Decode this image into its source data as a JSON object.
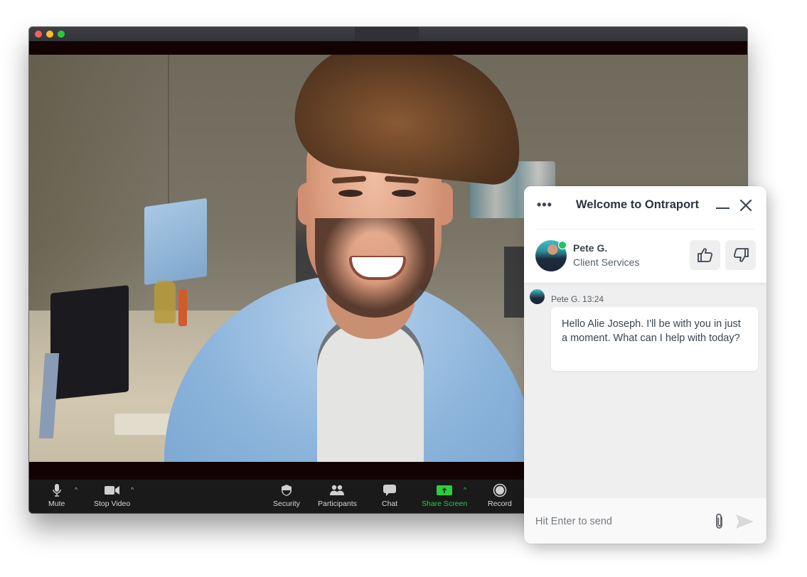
{
  "window": {
    "controls": [
      "close",
      "minimize",
      "zoom"
    ]
  },
  "toolbar": {
    "items": [
      {
        "id": "mute",
        "label": "Mute",
        "icon": "microphone-icon",
        "has_caret": true
      },
      {
        "id": "stop-video",
        "label": "Stop Video",
        "icon": "video-camera-icon",
        "has_caret": true
      },
      {
        "id": "security",
        "label": "Security",
        "icon": "shield-icon",
        "has_caret": false
      },
      {
        "id": "participants",
        "label": "Participants",
        "icon": "participants-icon",
        "has_caret": false
      },
      {
        "id": "chat",
        "label": "Chat",
        "icon": "chat-bubble-icon",
        "has_caret": false
      },
      {
        "id": "share-screen",
        "label": "Share Screen",
        "icon": "share-screen-icon",
        "has_caret": true
      },
      {
        "id": "record",
        "label": "Record",
        "icon": "record-icon",
        "has_caret": false
      }
    ],
    "caret_glyph": "^",
    "share_color": "#27d13e"
  },
  "chat_widget": {
    "menu_glyph": "•••",
    "title": "Welcome to Ontraport",
    "agent": {
      "name": "Pete G.",
      "role": "Client Services",
      "status": "online",
      "status_color": "#1fc55a"
    },
    "rating": {
      "thumbs_up": "thumbs-up",
      "thumbs_down": "thumbs-down"
    },
    "messages": [
      {
        "sender": "Pete G.",
        "time": "13:24",
        "meta": "Pete G. 13:24",
        "text": "Hello Alie Joseph. I'll be with you in just a moment. What can I help with today?"
      }
    ],
    "composer": {
      "placeholder": "Hit Enter to send",
      "value": ""
    }
  }
}
